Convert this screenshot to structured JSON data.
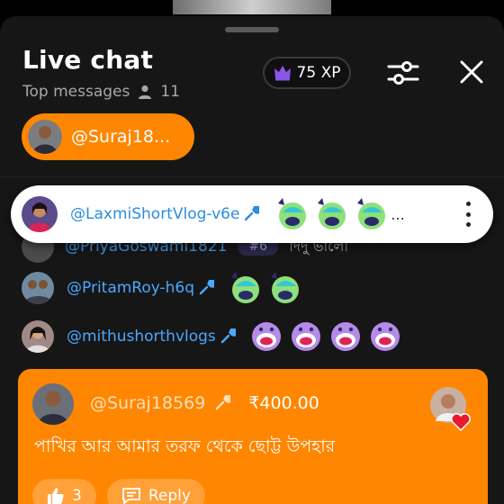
{
  "header": {
    "title": "Live chat",
    "mode_label": "Top messages",
    "viewer_count": "11",
    "xp_label": "75 XP"
  },
  "pinned": {
    "username": "@Suraj18..."
  },
  "popup_message": {
    "username": "@LaxmiShortVlog-v6e",
    "emoji_names": [
      "laughing-face-emoji",
      "laughing-face-emoji",
      "laughing-face-emoji"
    ],
    "overflow": "..."
  },
  "partial_message": {
    "username": "@PriyaGoswami1821",
    "badge": "#6",
    "text": "দিদু ভালো"
  },
  "messages": [
    {
      "username": "@PritamRoy-h6q",
      "emoji_names": [
        "laughing-face-emoji",
        "laughing-face-emoji"
      ]
    },
    {
      "username": "@mithushorthvlogs",
      "emoji_names": [
        "screaming-face-emoji",
        "screaming-face-emoji",
        "screaming-face-emoji",
        "screaming-face-emoji"
      ]
    }
  ],
  "super_chat": {
    "username": "@Suraj18569",
    "amount": "₹400.00",
    "message": "পাখির আর আমার তরফ থেকে ছোট্ট উপহার",
    "like_count": "3",
    "reply_label": "Reply",
    "accent_color": "#ff8600"
  },
  "colors": {
    "sheet_bg": "#161616",
    "username_blue": "#4aa8ff",
    "accent_orange": "#ff8600",
    "crown_purple": "#8a56e8"
  }
}
